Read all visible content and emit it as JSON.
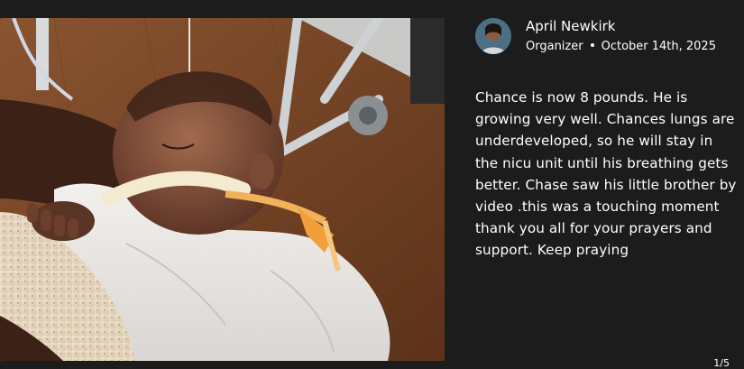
{
  "post": {
    "author_name": "April Newkirk",
    "author_role": "Organizer",
    "date": "October 14th, 2025",
    "body": "Chance is now 8 pounds. He is\ngrowing very well. Chances lungs are\nunderdeveloped, so he will stay in\nthe nicu unit until his breathing gets\nbetter. Chase saw his little brother by\nvideo .this was a touching moment\nthank you all for your prayers and\nsupport. Keep praying"
  },
  "pager": {
    "label": "1/5"
  },
  "icons": {
    "avatar": "person-photo",
    "separator": "dot"
  },
  "colors": {
    "background": "#1c1c1c",
    "text": "#ffffff"
  }
}
